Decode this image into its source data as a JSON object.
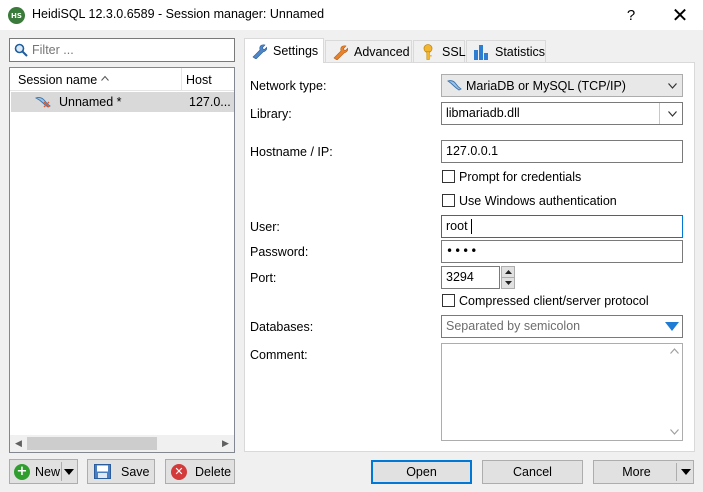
{
  "window": {
    "title": "HeidiSQL 12.3.0.6589 - Session manager: Unnamed",
    "app_icon_text": "HS",
    "help_label": "?",
    "close_label": "✕"
  },
  "filter": {
    "placeholder": "Filter ..."
  },
  "session_list": {
    "columns": [
      "Session name",
      "Host"
    ],
    "sessions": [
      {
        "name": "Unnamed *",
        "host": "127.0..."
      }
    ]
  },
  "left_buttons": {
    "new": "New",
    "save": "Save",
    "delete": "Delete"
  },
  "tabs": [
    {
      "label": "Settings",
      "active": true
    },
    {
      "label": "Advanced",
      "active": false
    },
    {
      "label": "SSL",
      "active": false
    },
    {
      "label": "Statistics",
      "active": false
    }
  ],
  "settings": {
    "network_type": {
      "label": "Network type:",
      "value": "MariaDB or MySQL (TCP/IP)"
    },
    "library": {
      "label": "Library:",
      "value": "libmariadb.dll"
    },
    "hostname": {
      "label": "Hostname / IP:",
      "value": "127.0.0.1"
    },
    "prompt_credentials": {
      "label": "Prompt for credentials",
      "checked": false
    },
    "windows_auth": {
      "label": "Use Windows authentication",
      "checked": false
    },
    "user": {
      "label": "User:",
      "value": "root"
    },
    "password": {
      "label": "Password:",
      "value": "••••"
    },
    "port": {
      "label": "Port:",
      "value": "3294"
    },
    "compressed": {
      "label": "Compressed client/server protocol",
      "checked": false
    },
    "databases": {
      "label": "Databases:",
      "placeholder": "Separated by semicolon"
    },
    "comment": {
      "label": "Comment:",
      "value": ""
    }
  },
  "bottom_buttons": {
    "open": "Open",
    "cancel": "Cancel",
    "more": "More"
  },
  "colors": {
    "accent": "#0078d7",
    "selection": "#d9d9d9",
    "button_face": "#e1e1e1"
  }
}
